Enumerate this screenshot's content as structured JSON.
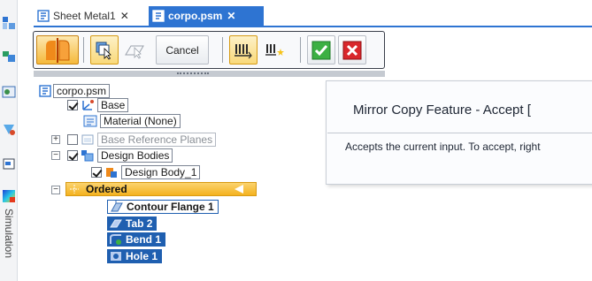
{
  "tabs": [
    {
      "label": "Sheet Metal1",
      "active": false
    },
    {
      "label": "corpo.psm",
      "active": true
    }
  ],
  "side_rail": {
    "label": "Simulation"
  },
  "command_bar": {
    "cancel_label": "Cancel",
    "accent_colors": {
      "accept": "#3cb043",
      "reject": "#d9262b",
      "selected": "#f5b93b"
    }
  },
  "tooltip": {
    "title": "Mirror Copy Feature - Accept [",
    "body": "Accepts the current input.  To accept, right"
  },
  "tree": {
    "root": "corpo.psm",
    "items": {
      "base": "Base",
      "material": "Material (None)",
      "ref_planes": "Base Reference Planes",
      "design_bodies": "Design Bodies",
      "design_body_1": "Design Body_1",
      "ordered": "Ordered",
      "contour_flange": "Contour Flange 1",
      "tab2": "Tab 2",
      "bend1": "Bend 1",
      "hole1": "Hole 1"
    }
  }
}
